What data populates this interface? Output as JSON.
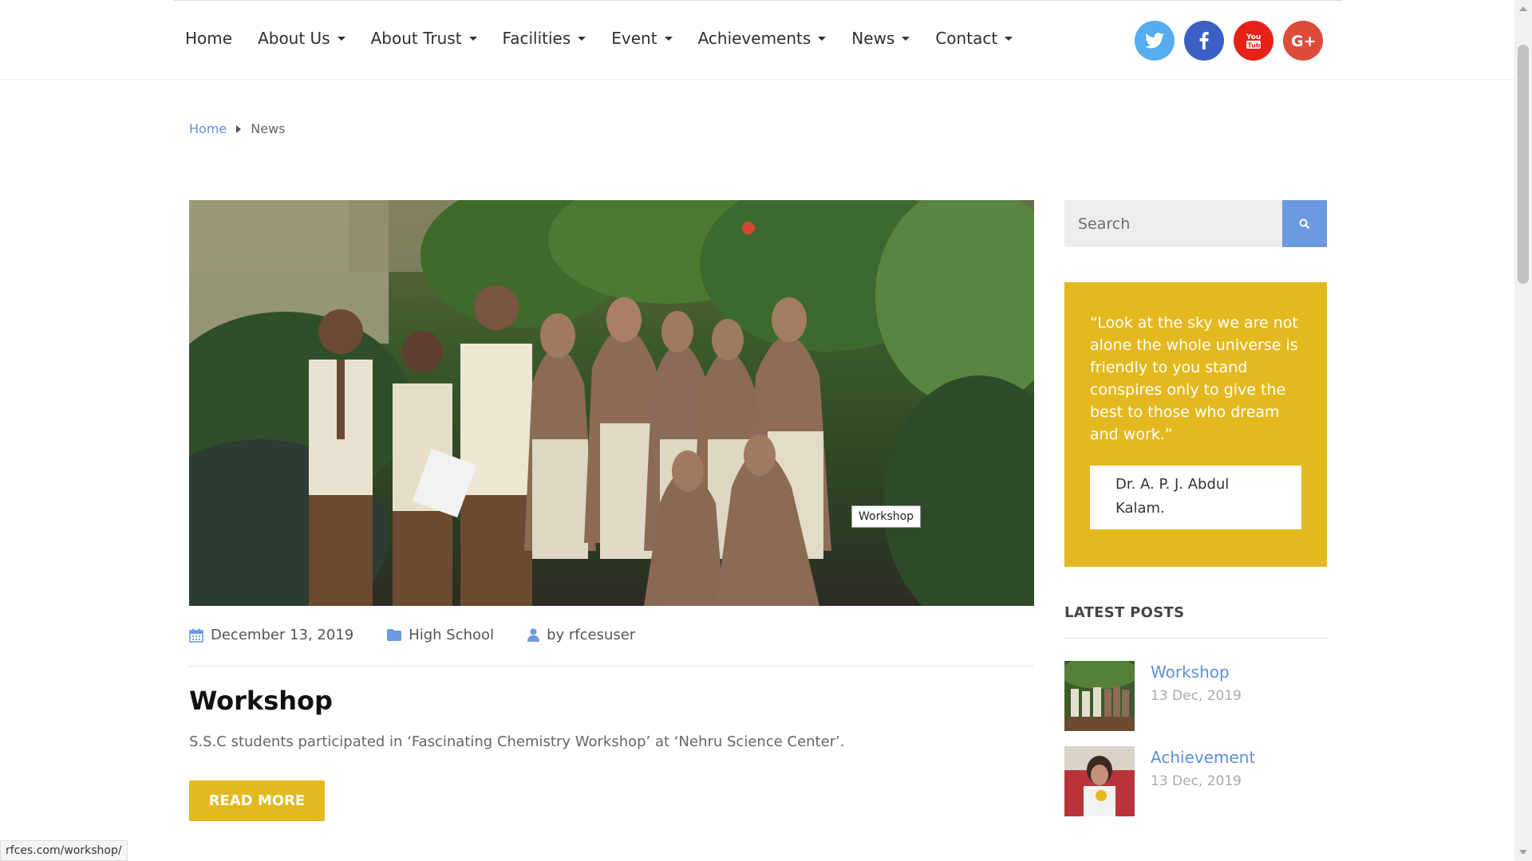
{
  "nav": {
    "items": [
      {
        "label": "Home",
        "dropdown": false
      },
      {
        "label": "About Us",
        "dropdown": true
      },
      {
        "label": "About Trust",
        "dropdown": true
      },
      {
        "label": "Facilities",
        "dropdown": true
      },
      {
        "label": "Event",
        "dropdown": true
      },
      {
        "label": "Achievements",
        "dropdown": true
      },
      {
        "label": "News",
        "dropdown": true
      },
      {
        "label": "Contact",
        "dropdown": true
      }
    ],
    "socials": [
      {
        "name": "twitter-icon",
        "glyph": "t",
        "color": "#55acee"
      },
      {
        "name": "facebook-icon",
        "glyph": "f",
        "color": "#3b5fc4"
      },
      {
        "name": "youtube-icon",
        "glyph": "You",
        "color": "#e62117"
      },
      {
        "name": "google-plus-icon",
        "glyph": "G+",
        "color": "#dd4b39"
      }
    ]
  },
  "breadcrumb": {
    "home": "Home",
    "current": "News"
  },
  "hero": {
    "tooltip": "Workshop"
  },
  "post": {
    "date": "December 13, 2019",
    "category": "High School",
    "author": "by rfcesuser",
    "title": "Workshop",
    "excerpt": "S.S.C students participated in ‘Fascinating Chemistry Workshop’ at ‘Nehru Science Center’.",
    "read_more": "READ MORE"
  },
  "sidebar": {
    "search_placeholder": "Search",
    "quote": "“Look at the sky we are not alone the whole universe is friendly to you stand conspires only to give the best to those who dream and work.”",
    "quote_author": "Dr. A. P. J. Abdul Kalam.",
    "latest_title": "LATEST POSTS",
    "latest_posts": [
      {
        "title": "Workshop",
        "date": "13 Dec, 2019"
      },
      {
        "title": "Achievement",
        "date": "13 Dec, 2019"
      }
    ]
  },
  "status_url": "rfces.com/workshop/",
  "colors": {
    "accent": "#e4b91f",
    "link": "#5e8fd6",
    "search_button": "#6b9ae0"
  }
}
